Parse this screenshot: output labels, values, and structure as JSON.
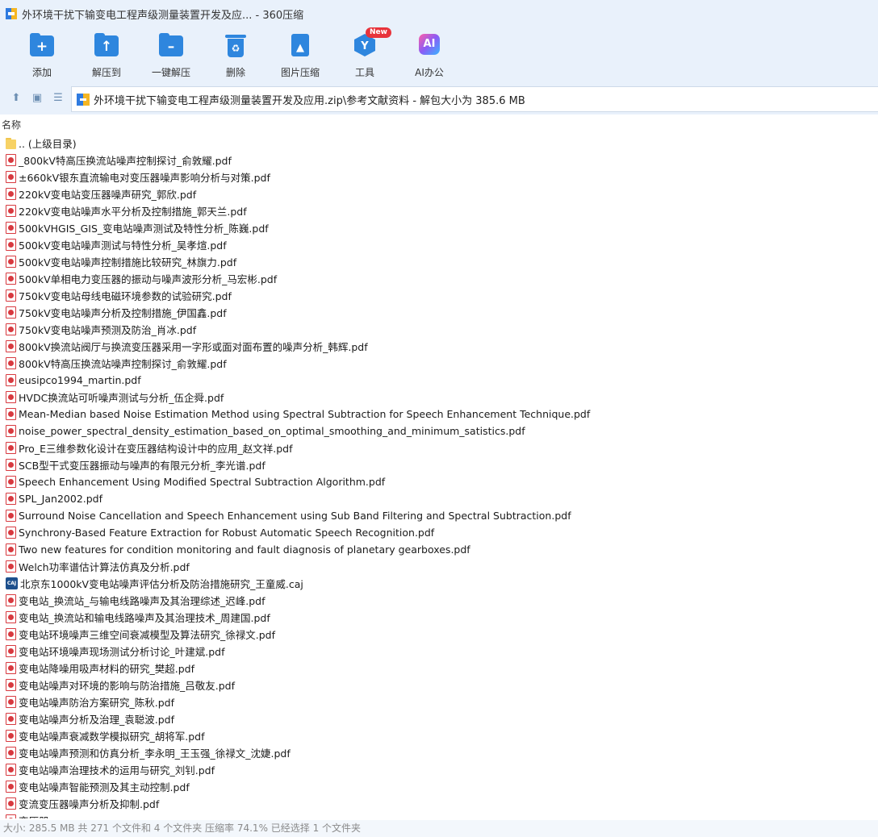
{
  "window": {
    "title": "外环境干扰下输变电工程声级测量装置开发及应... - 360压缩"
  },
  "toolbar": {
    "add": "添加",
    "extract_to": "解压到",
    "one_click": "一键解压",
    "delete": "删除",
    "image_compress": "图片压缩",
    "tools": "工具",
    "tools_badge": "New",
    "ai_office": "AI办公",
    "ai_icon_text": "AI"
  },
  "address": {
    "path": "外环境干扰下输变电工程声级测量装置开发及应用.zip\\参考文献资料 - 解包大小为 385.6 MB"
  },
  "columns": {
    "name": "名称"
  },
  "files": [
    {
      "name": ".. (上级目录)",
      "type": "folder"
    },
    {
      "name": "_800kV特高压换流站噪声控制探讨_俞敦耀.pdf",
      "type": "pdf"
    },
    {
      "name": "±660kV银东直流输电对变压器噪声影响分析与对策.pdf",
      "type": "pdf"
    },
    {
      "name": "220kV变电站变压器噪声研究_郭欣.pdf",
      "type": "pdf"
    },
    {
      "name": "220kV变电站噪声水平分析及控制措施_郭天兰.pdf",
      "type": "pdf"
    },
    {
      "name": "500kVHGIS_GIS_变电站噪声测试及特性分析_陈巍.pdf",
      "type": "pdf"
    },
    {
      "name": "500kV变电站噪声测试与特性分析_吴孝煊.pdf",
      "type": "pdf"
    },
    {
      "name": "500kV变电站噪声控制措施比较研究_林旗力.pdf",
      "type": "pdf"
    },
    {
      "name": "500kV单相电力变压器的振动与噪声波形分析_马宏彬.pdf",
      "type": "pdf"
    },
    {
      "name": "750kV变电站母线电磁环境参数的试验研究.pdf",
      "type": "pdf"
    },
    {
      "name": "750kV变电站噪声分析及控制措施_伊国鑫.pdf",
      "type": "pdf"
    },
    {
      "name": "750kV变电站噪声预测及防治_肖冰.pdf",
      "type": "pdf"
    },
    {
      "name": "800kV换流站阀厅与换流变压器采用一字形或面对面布置的噪声分析_韩辉.pdf",
      "type": "pdf"
    },
    {
      "name": "800kV特高压换流站噪声控制探讨_俞敦耀.pdf",
      "type": "pdf"
    },
    {
      "name": "eusipco1994_martin.pdf",
      "type": "pdf"
    },
    {
      "name": "HVDC换流站可听噪声测试与分析_伍企舜.pdf",
      "type": "pdf"
    },
    {
      "name": "Mean-Median based Noise Estimation Method using Spectral Subtraction for Speech Enhancement Technique.pdf",
      "type": "pdf"
    },
    {
      "name": "noise_power_spectral_density_estimation_based_on_optimal_smoothing_and_minimum_satistics.pdf",
      "type": "pdf"
    },
    {
      "name": "Pro_E三维参数化设计在变压器结构设计中的应用_赵文祥.pdf",
      "type": "pdf"
    },
    {
      "name": "SCB型干式变压器振动与噪声的有限元分析_李光谱.pdf",
      "type": "pdf"
    },
    {
      "name": "Speech Enhancement Using Modified Spectral Subtraction Algorithm.pdf",
      "type": "pdf"
    },
    {
      "name": "SPL_Jan2002.pdf",
      "type": "pdf"
    },
    {
      "name": "Surround Noise Cancellation and Speech Enhancement using Sub Band Filtering and Spectral Subtraction.pdf",
      "type": "pdf"
    },
    {
      "name": "Synchrony-Based Feature Extraction for Robust Automatic Speech Recognition.pdf",
      "type": "pdf"
    },
    {
      "name": "Two new features for condition monitoring and fault diagnosis of planetary gearboxes.pdf",
      "type": "pdf"
    },
    {
      "name": "Welch功率谱估计算法仿真及分析.pdf",
      "type": "pdf"
    },
    {
      "name": "北京东1000kV变电站噪声评估分析及防治措施研究_王童威.caj",
      "type": "caj",
      "icon_text": "CAJ"
    },
    {
      "name": "变电站_换流站_与输电线路噪声及其治理综述_迟峰.pdf",
      "type": "pdf"
    },
    {
      "name": "变电站_换流站和输电线路噪声及其治理技术_周建国.pdf",
      "type": "pdf"
    },
    {
      "name": "变电站环境噪声三维空间衰减模型及算法研究_徐禄文.pdf",
      "type": "pdf"
    },
    {
      "name": "变电站环境噪声现场测试分析讨论_叶建斌.pdf",
      "type": "pdf"
    },
    {
      "name": "变电站降噪用吸声材料的研究_樊超.pdf",
      "type": "pdf"
    },
    {
      "name": "变电站噪声对环境的影响与防治措施_吕敬友.pdf",
      "type": "pdf"
    },
    {
      "name": "变电站噪声防治方案研究_陈秋.pdf",
      "type": "pdf"
    },
    {
      "name": "变电站噪声分析及治理_袁聪波.pdf",
      "type": "pdf"
    },
    {
      "name": "变电站噪声衰减数学模拟研究_胡将军.pdf",
      "type": "pdf"
    },
    {
      "name": "变电站噪声预测和仿真分析_李永明_王玉强_徐禄文_沈婕.pdf",
      "type": "pdf"
    },
    {
      "name": "变电站噪声治理技术的运用与研究_刘钊.pdf",
      "type": "pdf"
    },
    {
      "name": "变电站噪声智能预测及其主动控制.pdf",
      "type": "pdf"
    },
    {
      "name": "变流变压器噪声分析及抑制.pdf",
      "type": "pdf"
    },
    {
      "name": "变压器...",
      "type": "pdf"
    }
  ],
  "status": {
    "text": "大小: 285.5 MB 共 271 个文件和 4 个文件夹 压缩率 74.1% 已经选择 1 个文件夹"
  },
  "colors": {
    "accent": "#2e86de",
    "pdf_red": "#d7393f",
    "folder_yellow": "#f7d265",
    "chrome_bg": "#e9f1fb"
  }
}
